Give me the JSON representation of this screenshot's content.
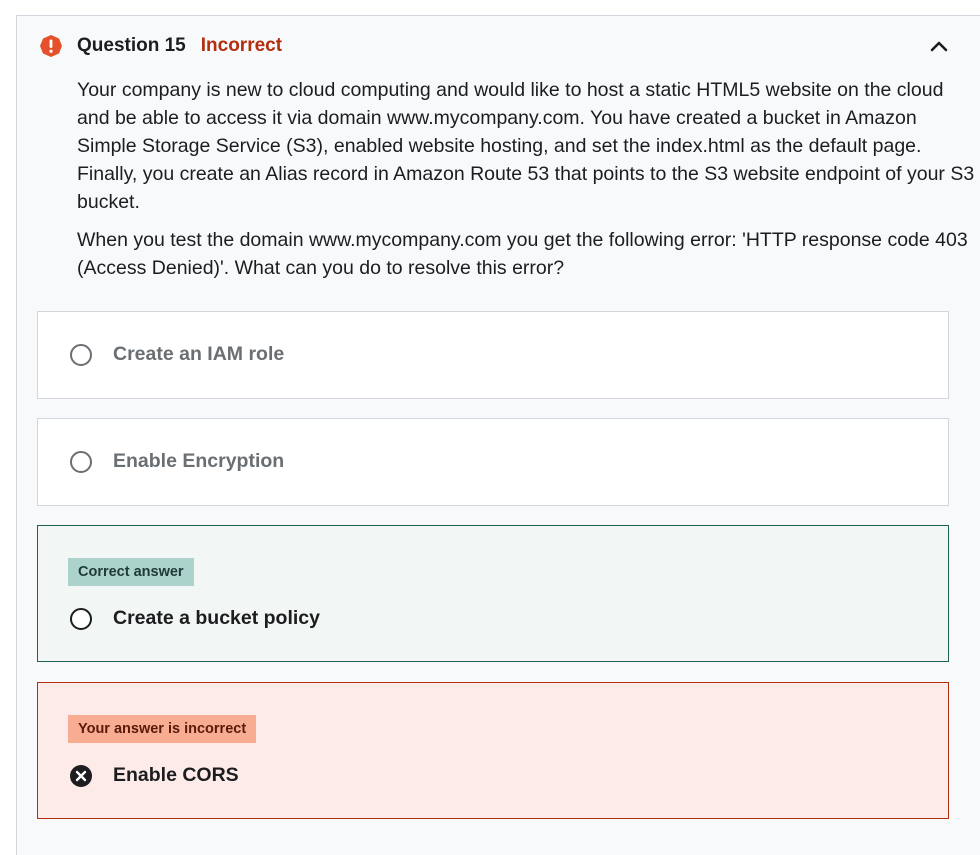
{
  "question": {
    "title": "Question 15",
    "status": "Incorrect",
    "paragraphs": [
      "Your company is new to cloud computing and would like to host a static HTML5 website on the cloud and be able to access it via domain www.mycompany.com. You have created a bucket in Amazon Simple Storage Service (S3), enabled website hosting, and set the index.html as the default page. Finally, you create an Alias record in Amazon Route 53 that points to the S3 website endpoint of your S3 bucket.",
      "When you test the domain www.mycompany.com you get the following error: 'HTTP response code 403 (Access Denied)'. What can you do to resolve this error?"
    ]
  },
  "options": [
    {
      "label": "Create an IAM role"
    },
    {
      "label": "Enable Encryption"
    },
    {
      "label": "Create a bucket policy",
      "tag": "Correct answer"
    },
    {
      "label": "Enable CORS",
      "tag": "Your answer is incorrect"
    }
  ],
  "icons": {
    "alert": "alert-icon",
    "collapse": "chevron-up-icon",
    "wrong": "x-circle-icon"
  },
  "colors": {
    "incorrect": "#b32d0f",
    "alert_icon": "#e4512b",
    "correct_border": "#1e6055",
    "correct_bg": "#f2f7f6",
    "correct_tag": "#acd2cc",
    "wrong_border": "#b32d0f",
    "wrong_bg": "#fcebe8",
    "wrong_tag": "#f8ad93"
  }
}
